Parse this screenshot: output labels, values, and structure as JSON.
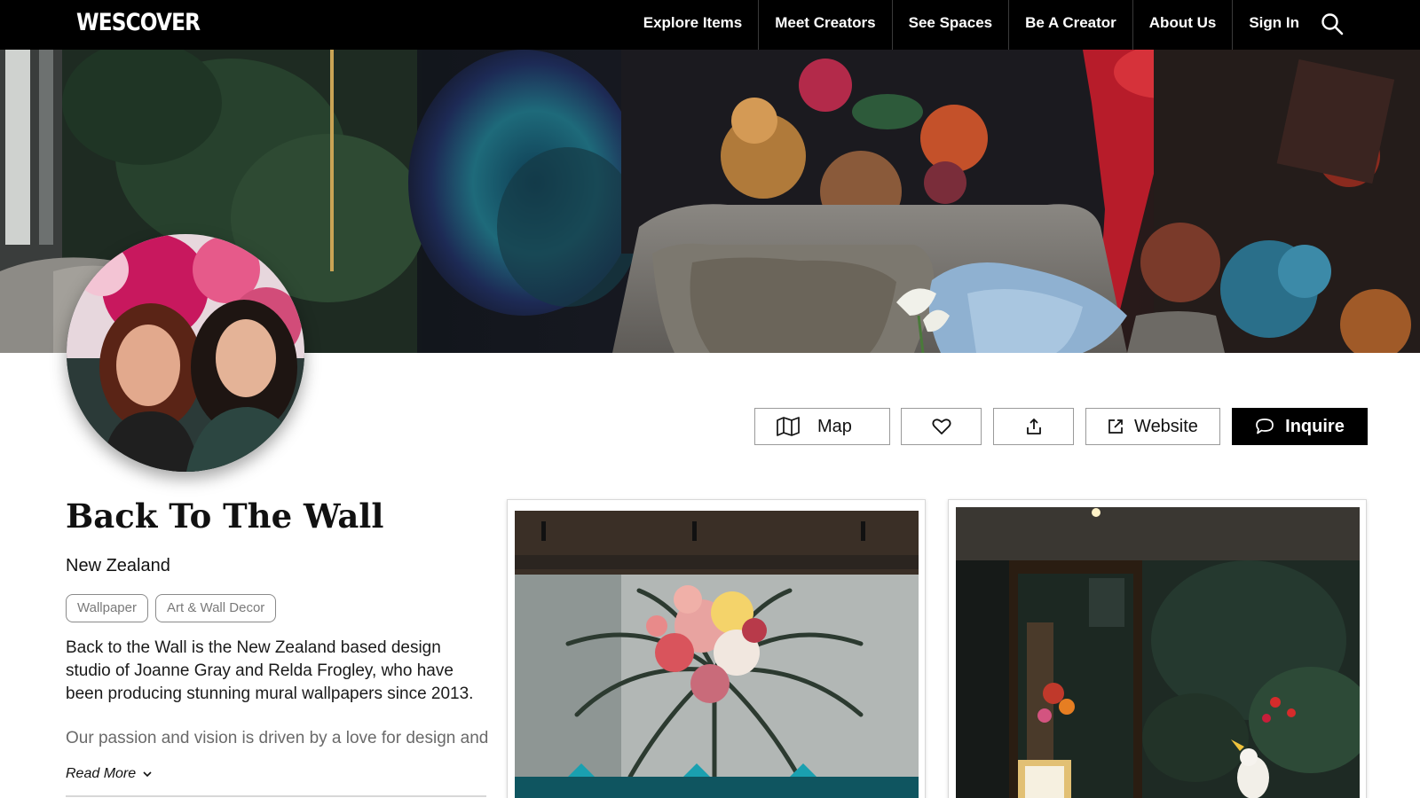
{
  "nav": {
    "logo": "WESCOVER",
    "links": [
      {
        "label": "Explore Items"
      },
      {
        "label": "Meet Creators"
      },
      {
        "label": "See Spaces"
      },
      {
        "label": "Be A Creator"
      },
      {
        "label": "About Us"
      },
      {
        "label": "Sign In"
      }
    ],
    "search_icon": "search-icon"
  },
  "hero": {
    "image": "hero-banner-image"
  },
  "profile": {
    "avatar": "profile-avatar",
    "name": "Back To The Wall",
    "location": "New Zealand",
    "tags": [
      "Wallpaper",
      "Art & Wall Decor"
    ],
    "bio": "Back to the Wall is the New Zealand based design studio of Joanne Gray and Relda Frogley, who have been producing stunning mural wallpapers since 2013.",
    "bio_more": "Our passion and vision is driven by a love for design and",
    "read_more": "Read More"
  },
  "actions": {
    "map": {
      "label": "Map",
      "icon": "map-icon"
    },
    "favorite": {
      "icon": "heart-icon"
    },
    "share": {
      "icon": "share-icon"
    },
    "website": {
      "label": "Website",
      "icon": "external-link-icon"
    },
    "inquire": {
      "label": "Inquire",
      "icon": "chat-bubble-icon"
    }
  },
  "gallery": {
    "items": [
      {
        "image": "gallery-image-palm-floral-mural"
      },
      {
        "image": "gallery-image-jungle-mural"
      }
    ]
  },
  "colors": {
    "nav_bg": "#000000",
    "inquire_bg": "#000000",
    "tag_border": "#8a8a8a",
    "button_border": "#9a9a9a"
  }
}
